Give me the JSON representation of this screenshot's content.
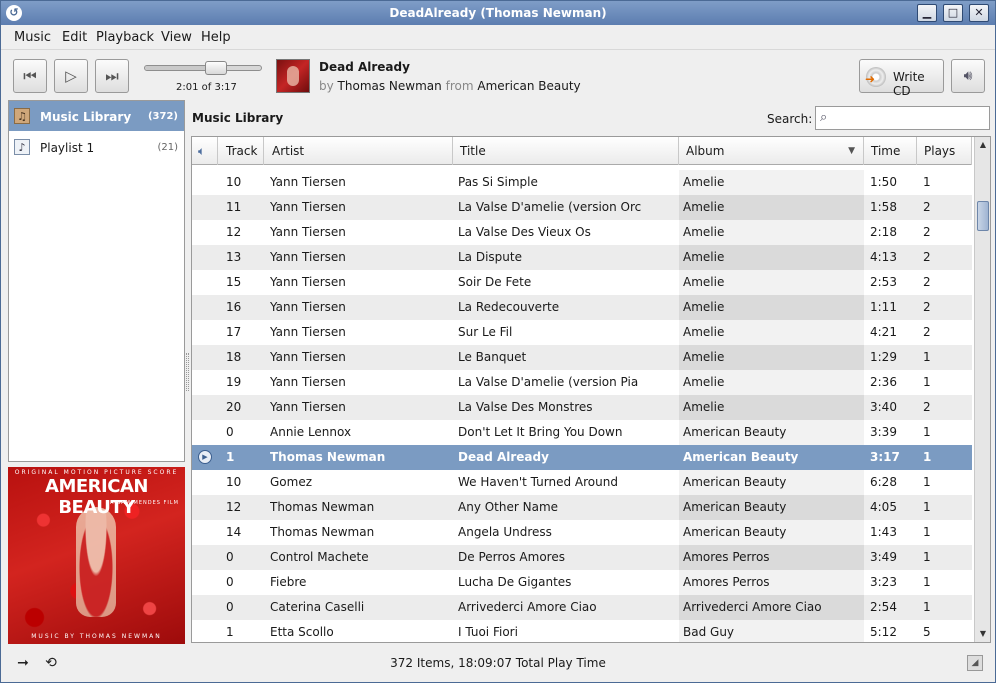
{
  "window": {
    "title": "DeadAlready (Thomas Newman)"
  },
  "menu": [
    "Music",
    "Edit",
    "Playback",
    "View",
    "Help"
  ],
  "player": {
    "time_text": "2:01 of 3:17",
    "progress": 0.615,
    "track_title": "Dead Already",
    "by_label": "by",
    "artist": "Thomas Newman",
    "from_label": "from",
    "album": "American Beauty",
    "write_cd_label": "Write CD"
  },
  "sidebar": {
    "items": [
      {
        "label": "Music Library",
        "count": "(372)"
      },
      {
        "label": "Playlist 1",
        "count": "(21)"
      }
    ]
  },
  "album_art": {
    "top_text": "ORIGINAL MOTION PICTURE SCORE",
    "title": "AMERICAN BEAUTY",
    "sub_text": "A SAM MENDES FILM",
    "credit": "MUSIC BY THOMAS NEWMAN"
  },
  "main": {
    "title": "Music Library",
    "search_label": "Search:",
    "search_value": ""
  },
  "table": {
    "columns": [
      "Track",
      "Artist",
      "Title",
      "Album",
      "Time",
      "Plays"
    ],
    "rows": [
      {
        "track": "10",
        "artist": "Yann Tiersen",
        "title": "Pas Si Simple",
        "album": "Amelie",
        "time": "1:50",
        "plays": "1"
      },
      {
        "track": "11",
        "artist": "Yann Tiersen",
        "title": "La Valse D'amelie (version Orc",
        "album": "Amelie",
        "time": "1:58",
        "plays": "2"
      },
      {
        "track": "12",
        "artist": "Yann Tiersen",
        "title": "La Valse Des Vieux Os",
        "album": "Amelie",
        "time": "2:18",
        "plays": "2"
      },
      {
        "track": "13",
        "artist": "Yann Tiersen",
        "title": "La Dispute",
        "album": "Amelie",
        "time": "4:13",
        "plays": "2"
      },
      {
        "track": "15",
        "artist": "Yann Tiersen",
        "title": "Soir De Fete",
        "album": "Amelie",
        "time": "2:53",
        "plays": "2"
      },
      {
        "track": "16",
        "artist": "Yann Tiersen",
        "title": "La Redecouverte",
        "album": "Amelie",
        "time": "1:11",
        "plays": "2"
      },
      {
        "track": "17",
        "artist": "Yann Tiersen",
        "title": "Sur Le Fil",
        "album": "Amelie",
        "time": "4:21",
        "plays": "2"
      },
      {
        "track": "18",
        "artist": "Yann Tiersen",
        "title": "Le Banquet",
        "album": "Amelie",
        "time": "1:29",
        "plays": "1"
      },
      {
        "track": "19",
        "artist": "Yann Tiersen",
        "title": "La Valse D'amelie (version Pia",
        "album": "Amelie",
        "time": "2:36",
        "plays": "1"
      },
      {
        "track": "20",
        "artist": "Yann Tiersen",
        "title": "La Valse Des Monstres",
        "album": "Amelie",
        "time": "3:40",
        "plays": "2"
      },
      {
        "track": "0",
        "artist": "Annie Lennox",
        "title": "Don't Let It Bring You Down",
        "album": "American Beauty",
        "time": "3:39",
        "plays": "1"
      },
      {
        "track": "1",
        "artist": "Thomas Newman",
        "title": "Dead Already",
        "album": "American Beauty",
        "time": "3:17",
        "plays": "1",
        "playing": true
      },
      {
        "track": "10",
        "artist": "Gomez",
        "title": "We Haven't Turned Around",
        "album": "American Beauty",
        "time": "6:28",
        "plays": "1"
      },
      {
        "track": "12",
        "artist": "Thomas Newman",
        "title": "Any Other Name",
        "album": "American Beauty",
        "time": "4:05",
        "plays": "1"
      },
      {
        "track": "14",
        "artist": "Thomas Newman",
        "title": "Angela Undress",
        "album": "American Beauty",
        "time": "1:43",
        "plays": "1"
      },
      {
        "track": "0",
        "artist": "Control Machete",
        "title": "De Perros Amores",
        "album": "Amores Perros",
        "time": "3:49",
        "plays": "1"
      },
      {
        "track": "0",
        "artist": "Fiebre",
        "title": "Lucha De Gigantes",
        "album": "Amores Perros",
        "time": "3:23",
        "plays": "1"
      },
      {
        "track": "0",
        "artist": "Caterina Caselli",
        "title": "Arrivederci Amore Ciao",
        "album": "Arrivederci Amore Ciao",
        "time": "2:54",
        "plays": "1"
      },
      {
        "track": "1",
        "artist": "Etta Scollo",
        "title": "I Tuoi Fiori",
        "album": "Bad Guy",
        "time": "5:12",
        "plays": "5"
      }
    ]
  },
  "status": {
    "text": "372 Items, 18:09:07 Total Play Time"
  },
  "colors": {
    "selection": "#7b9bc2",
    "titlebar": "#5c7db0"
  }
}
